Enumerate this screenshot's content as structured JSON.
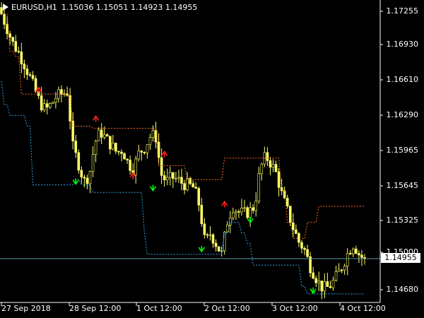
{
  "header": {
    "symbol": "EURUSD,H1",
    "ohlc": "1.15036 1.15051 1.14923 1.14955"
  },
  "price_axis": {
    "labels": [
      "1.17255",
      "1.16930",
      "1.16610",
      "1.16290",
      "1.15965",
      "1.15645",
      "1.15325",
      "1.15000",
      "1.14680"
    ],
    "current_price": "1.14955"
  },
  "time_axis": {
    "labels": [
      "27 Sep 2018",
      "28 Sep 12:00",
      "1 Oct 12:00",
      "2 Oct 12:00",
      "3 Oct 12:00",
      "4 Oct 12:00"
    ]
  },
  "colors": {
    "candle": "#ffff66",
    "upper_band": "#ff6a1a",
    "lower_band": "#2ea8e6",
    "buy_arrow": "#00ff00",
    "sell_arrow": "#ff2020",
    "price_line": "#6a9aa8",
    "axis": "#ffffff"
  },
  "chart_data": {
    "type": "candlestick",
    "x_labels": [
      "27 Sep 2018",
      "28 Sep 12:00",
      "1 Oct 12:00",
      "2 Oct 12:00",
      "3 Oct 12:00",
      "4 Oct 12:00"
    ],
    "ylim": [
      1.1455,
      1.1738
    ],
    "close_path": [
      1.1725,
      1.1712,
      1.1698,
      1.169,
      1.168,
      1.1668,
      1.1655,
      1.1642,
      1.1635,
      1.164,
      1.1648,
      1.165,
      1.1652,
      1.16,
      1.1585,
      1.1568,
      1.1575,
      1.1605,
      1.1615,
      1.1608,
      1.1602,
      1.1595,
      1.1598,
      1.1585,
      1.158,
      1.1595,
      1.16,
      1.161,
      1.1612,
      1.1575,
      1.1568,
      1.1572,
      1.157,
      1.1566,
      1.1565,
      1.1562,
      1.1545,
      1.151,
      1.152,
      1.151,
      1.15,
      1.153,
      1.1545,
      1.154,
      1.1538,
      1.154,
      1.1545,
      1.158,
      1.1592,
      1.1585,
      1.1575,
      1.1555,
      1.154,
      1.1525,
      1.1512,
      1.1505,
      1.149,
      1.148,
      1.147,
      1.1468,
      1.1472,
      1.148,
      1.149,
      1.1502,
      1.151,
      1.15,
      1.1495
    ],
    "upper_band": [
      1.1725,
      1.1725,
      1.169,
      1.1685,
      1.165,
      1.165,
      1.165,
      1.165,
      1.165,
      1.165,
      1.165,
      1.165,
      1.165,
      1.162,
      1.162,
      1.162,
      1.162,
      1.1618,
      1.1618,
      1.1618,
      1.1618,
      1.1618,
      1.1618,
      1.1618,
      1.1618,
      1.1618,
      1.1618,
      1.1618,
      1.1618,
      1.1583,
      1.1583,
      1.1583,
      1.1583,
      1.1583,
      1.157,
      1.157,
      1.157,
      1.157,
      1.157,
      1.157,
      1.157,
      1.159,
      1.159,
      1.159,
      1.159,
      1.159,
      1.159,
      1.159,
      1.159,
      1.159,
      1.159,
      1.156,
      1.153,
      1.1515,
      1.1515,
      1.1515,
      1.153,
      1.153,
      1.1545,
      1.1545,
      1.1545,
      1.1545,
      1.1545,
      1.1545,
      1.1545,
      1.1545,
      1.1545
    ],
    "lower_band": [
      1.1662,
      1.164,
      1.163,
      1.163,
      1.163,
      1.162,
      1.1565,
      1.1565,
      1.1565,
      1.1565,
      1.1565,
      1.1565,
      1.1565,
      1.1565,
      1.157,
      1.1565,
      1.1565,
      1.1558,
      1.1558,
      1.1558,
      1.1558,
      1.1558,
      1.1558,
      1.1558,
      1.1558,
      1.1558,
      1.152,
      1.15,
      1.15,
      1.15,
      1.15,
      1.15,
      1.15,
      1.15,
      1.15,
      1.15,
      1.15,
      1.15,
      1.15,
      1.15,
      1.15,
      1.152,
      1.153,
      1.153,
      1.152,
      1.151,
      1.149,
      1.149,
      1.149,
      1.149,
      1.149,
      1.149,
      1.149,
      1.149,
      1.149,
      1.147,
      1.1463,
      1.1463,
      1.1463,
      1.1463,
      1.1463,
      1.1463,
      1.1463,
      1.1463,
      1.1463,
      1.1463,
      1.1463
    ],
    "sell_arrows": [
      [
        13,
        1.1655
      ],
      [
        33,
        1.1628
      ],
      [
        46,
        1.1575
      ],
      [
        57,
        1.1595
      ],
      [
        78,
        1.1548
      ]
    ],
    "buy_arrows": [
      [
        26,
        1.1567
      ],
      [
        53,
        1.1561
      ],
      [
        70,
        1.1504
      ],
      [
        87,
        1.1531
      ],
      [
        109,
        1.1465
      ]
    ],
    "current_price": 1.14955
  }
}
